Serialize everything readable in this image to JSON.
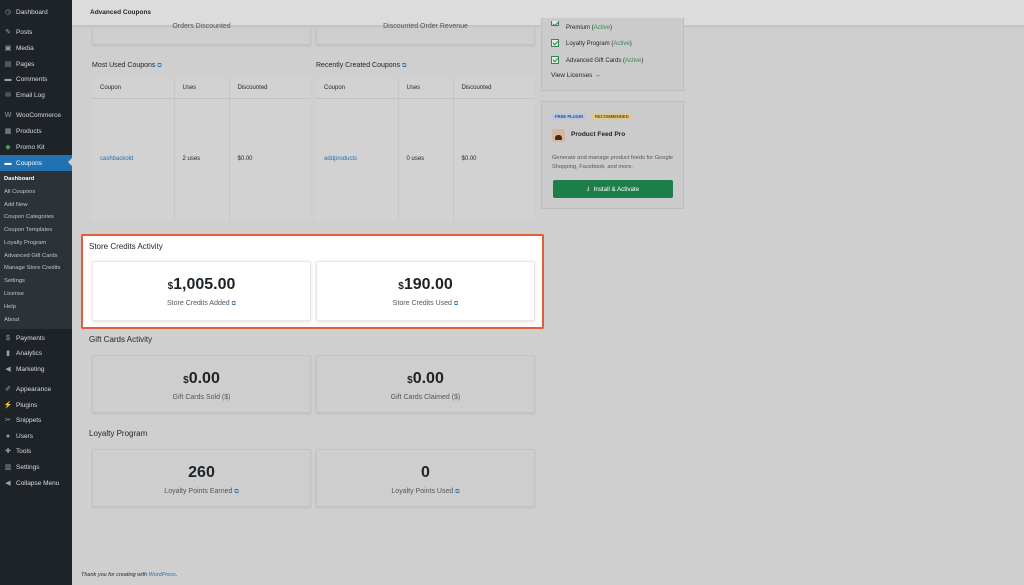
{
  "sidebar": {
    "items": [
      {
        "label": "Dashboard",
        "icon": "dashboard-icon",
        "glyph": "◷"
      },
      {
        "label": "Posts",
        "icon": "pin-icon",
        "glyph": "✎"
      },
      {
        "label": "Media",
        "icon": "media-icon",
        "glyph": "▣"
      },
      {
        "label": "Pages",
        "icon": "pages-icon",
        "glyph": "▤"
      },
      {
        "label": "Comments",
        "icon": "comments-icon",
        "glyph": "▬"
      },
      {
        "label": "Email Log",
        "icon": "email-icon",
        "glyph": "✉"
      },
      {
        "label": "WooCommerce",
        "icon": "woocommerce-icon",
        "glyph": "W"
      },
      {
        "label": "Products",
        "icon": "products-icon",
        "glyph": "▦"
      },
      {
        "label": "Promo Kit",
        "icon": "promo-kit-icon",
        "glyph": "◆"
      },
      {
        "label": "Coupons",
        "icon": "coupons-icon",
        "glyph": "▬"
      },
      {
        "label": "Payments",
        "icon": "payments-icon",
        "glyph": "$"
      },
      {
        "label": "Analytics",
        "icon": "analytics-icon",
        "glyph": "▮"
      },
      {
        "label": "Marketing",
        "icon": "marketing-icon",
        "glyph": "◀"
      },
      {
        "label": "Appearance",
        "icon": "appearance-icon",
        "glyph": "✐"
      },
      {
        "label": "Plugins",
        "icon": "plugins-icon",
        "glyph": "⚡"
      },
      {
        "label": "Snippets",
        "icon": "snippets-icon",
        "glyph": "✂"
      },
      {
        "label": "Users",
        "icon": "users-icon",
        "glyph": "●"
      },
      {
        "label": "Tools",
        "icon": "tools-icon",
        "glyph": "✚"
      },
      {
        "label": "Settings",
        "icon": "settings-icon",
        "glyph": "▥"
      },
      {
        "label": "Collapse Menu",
        "icon": "collapse-icon",
        "glyph": "◀"
      }
    ],
    "submenu": [
      "Dashboard",
      "All Coupons",
      "Add New",
      "Coupon Categories",
      "Coupon Templates",
      "Loyalty Program",
      "Advanced Gift Cards",
      "Manage Store Credits",
      "Settings",
      "License",
      "Help",
      "About"
    ]
  },
  "topbar": {
    "title": "Advanced Coupons"
  },
  "partial_cards": {
    "orders_discounted": "Orders Discounted",
    "discounted_revenue": "Discounted Order Revenue"
  },
  "most_used": {
    "title": "Most Used Coupons",
    "headers": [
      "Coupon",
      "Uses",
      "Discounted"
    ],
    "row": [
      "cashbackold",
      "2 uses",
      "$0.00"
    ]
  },
  "recent": {
    "title": "Recently Created Coupons",
    "headers": [
      "Coupon",
      "Uses",
      "Discounted"
    ],
    "row": [
      "addproducts",
      "0 uses",
      "$0.00"
    ]
  },
  "store_credits": {
    "title": "Store Credits Activity",
    "added": {
      "currency": "$",
      "amount": "1,005.00",
      "label": "Store Credits Added"
    },
    "used": {
      "currency": "$",
      "amount": "190.00",
      "label": "Store Credits Used"
    }
  },
  "gift_cards": {
    "title": "Gift Cards Activity",
    "sold": {
      "currency": "$",
      "amount": "0.00",
      "label": "Gift Cards Sold ($)"
    },
    "claimed": {
      "currency": "$",
      "amount": "0.00",
      "label": "Gift Cards Claimed ($)"
    }
  },
  "loyalty": {
    "title": "Loyalty Program",
    "earned": {
      "value": "260",
      "label": "Loyalty Points Earned"
    },
    "used": {
      "value": "0",
      "label": "Loyalty Points Used"
    }
  },
  "licenses": {
    "items": [
      {
        "name": "Premium",
        "status": "Active"
      },
      {
        "name": "Loyalty Program",
        "status": "Active"
      },
      {
        "name": "Advanced Gift Cards",
        "status": "Active"
      }
    ],
    "view_link": "View Licenses →"
  },
  "promo": {
    "badge_free": "FREE PLUGIN",
    "badge_recommended": "RECOMMENDED",
    "name": "Product Feed Pro",
    "description": "Generate and manage product feeds for Google Shopping, Facebook, and more.",
    "button": "Install & Activate"
  },
  "footer": {
    "text_prefix": "Thank you for creating with ",
    "link": "WordPress",
    "suffix": "."
  },
  "colors": {
    "accent": "#2271b1",
    "active": "#2e8a4e",
    "highlight": "#e25c3d",
    "install": "#1e7e4a"
  }
}
